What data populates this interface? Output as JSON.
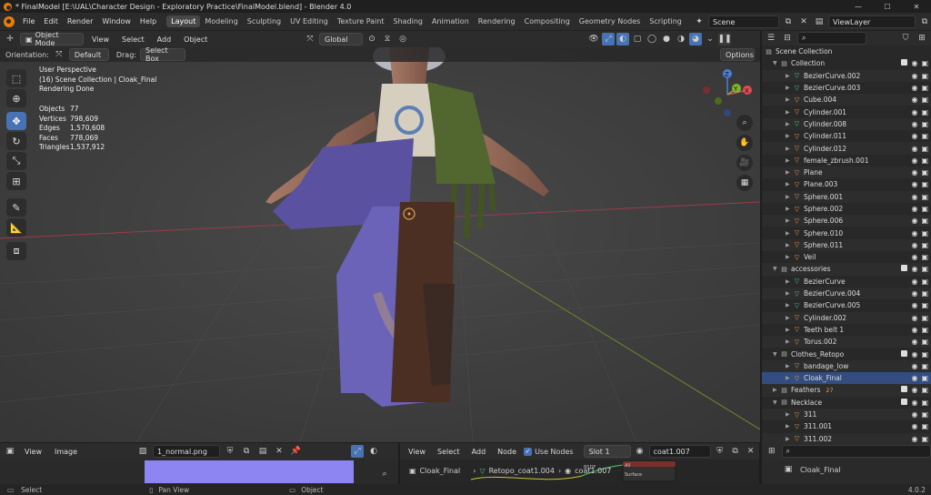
{
  "window": {
    "title": "* FinalModel [E:\\UAL\\Character Design - Exploratory Practice\\FinalModel.blend] - Blender 4.0",
    "controls": [
      "—",
      "☐",
      "✕"
    ]
  },
  "menu": {
    "items": [
      "File",
      "Edit",
      "Render",
      "Window",
      "Help"
    ]
  },
  "workspaces": [
    "Layout",
    "Modeling",
    "Sculpting",
    "UV Editing",
    "Texture Paint",
    "Shading",
    "Animation",
    "Rendering",
    "Compositing",
    "Geometry Nodes",
    "Scripting"
  ],
  "scene": {
    "name": "Scene",
    "view_layer": "ViewLayer"
  },
  "viewport_header": {
    "mode": "Object Mode",
    "view": "View",
    "select": "Select",
    "add": "Add",
    "object": "Object",
    "transform_orientation": "Global"
  },
  "viewport_sub": {
    "orientation_label": "Orientation:",
    "orientation_value": "Default",
    "drag_label": "Drag:",
    "drag_value": "Select Box",
    "options": "Options"
  },
  "overlay_text": {
    "perspective": "User Perspective",
    "collection": "(16) Scene Collection | Cloak_Final",
    "status": "Rendering Done"
  },
  "stats": [
    {
      "label": "Objects",
      "value": "77"
    },
    {
      "label": "Vertices",
      "value": "798,609"
    },
    {
      "label": "Edges",
      "value": "1,570,608"
    },
    {
      "label": "Faces",
      "value": "778,069"
    },
    {
      "label": "Triangles",
      "value": "1,537,912"
    }
  ],
  "gizmo": {
    "x": "X",
    "y": "Y",
    "z": "Z"
  },
  "outliner": {
    "root": "Scene Collection",
    "rows": [
      {
        "name": "Collection",
        "kind": "coll",
        "indent": 1,
        "open": true
      },
      {
        "name": "BezierCurve.002",
        "kind": "curve",
        "indent": 2
      },
      {
        "name": "BezierCurve.003",
        "kind": "curve",
        "indent": 2
      },
      {
        "name": "Cube.004",
        "kind": "mesh",
        "indent": 2
      },
      {
        "name": "Cylinder.001",
        "kind": "mesh",
        "indent": 2
      },
      {
        "name": "Cylinder.008",
        "kind": "curve",
        "indent": 2
      },
      {
        "name": "Cylinder.011",
        "kind": "mesh",
        "indent": 2
      },
      {
        "name": "Cylinder.012",
        "kind": "mesh",
        "indent": 2
      },
      {
        "name": "female_zbrush.001",
        "kind": "mesh",
        "indent": 2
      },
      {
        "name": "Plane",
        "kind": "mesh",
        "indent": 2
      },
      {
        "name": "Plane.003",
        "kind": "mesh",
        "indent": 2
      },
      {
        "name": "Sphere.001",
        "kind": "mesh",
        "indent": 2
      },
      {
        "name": "Sphere.002",
        "kind": "mesh",
        "indent": 2
      },
      {
        "name": "Sphere.006",
        "kind": "mesh",
        "indent": 2
      },
      {
        "name": "Sphere.010",
        "kind": "mesh",
        "indent": 2
      },
      {
        "name": "Sphere.011",
        "kind": "mesh",
        "indent": 2
      },
      {
        "name": "Veil",
        "kind": "mesh",
        "indent": 2
      },
      {
        "name": "accessories",
        "kind": "coll",
        "indent": 1,
        "open": true
      },
      {
        "name": "BezierCurve",
        "kind": "curve",
        "indent": 2
      },
      {
        "name": "BezierCurve.004",
        "kind": "curve",
        "indent": 2
      },
      {
        "name": "BezierCurve.005",
        "kind": "curve",
        "indent": 2
      },
      {
        "name": "Cylinder.002",
        "kind": "mesh",
        "indent": 2
      },
      {
        "name": "Teeth belt 1",
        "kind": "mesh",
        "indent": 2
      },
      {
        "name": "Torus.002",
        "kind": "mesh",
        "indent": 2
      },
      {
        "name": "Clothes_Retopo",
        "kind": "coll",
        "indent": 1,
        "open": true
      },
      {
        "name": "bandage_low",
        "kind": "mesh",
        "indent": 2
      },
      {
        "name": "Cloak_Final",
        "kind": "mesh",
        "indent": 2,
        "selected": true
      },
      {
        "name": "Feathers",
        "kind": "coll",
        "indent": 1,
        "open": false,
        "badge": "27"
      },
      {
        "name": "Necklace",
        "kind": "coll",
        "indent": 1,
        "open": true
      },
      {
        "name": "311",
        "kind": "mesh",
        "indent": 2
      },
      {
        "name": "311.001",
        "kind": "mesh",
        "indent": 2
      },
      {
        "name": "311.002",
        "kind": "mesh",
        "indent": 2
      }
    ]
  },
  "image_editor": {
    "view": "View",
    "image": "Image",
    "filename": "1_normal.png",
    "image_color": "#8d86f2"
  },
  "node_editor": {
    "view": "View",
    "select": "Select",
    "add": "Add",
    "node": "Node",
    "use_nodes": "Use Nodes",
    "slot": "Slot 1",
    "material": "coat1.007",
    "breadcrumb_object": "Cloak_Final",
    "breadcrumb_mesh": "Retopo_coat1.004",
    "breadcrumb_material": "coat1.007",
    "node_label_bsdf": "BSDF",
    "node_label_all": "All",
    "node_label_surface": "Surface"
  },
  "properties": {
    "object": "Cloak_Final"
  },
  "status": {
    "select": "Select",
    "pan": "Pan View",
    "object": "Object",
    "version": "4.0.2"
  }
}
